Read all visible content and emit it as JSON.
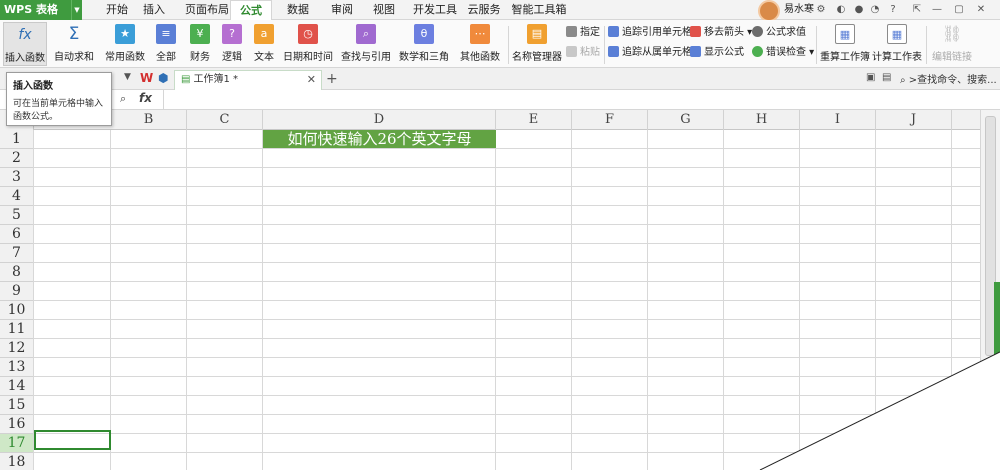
{
  "app": {
    "name": "WPS 表格"
  },
  "menu": {
    "tabs": [
      "开始",
      "插入",
      "页面布局",
      "公式",
      "数据",
      "审阅",
      "视图",
      "开发工具",
      "云服务",
      "智能工具箱"
    ],
    "active": "公式"
  },
  "user": {
    "name": "易水寒"
  },
  "ribbon": {
    "insert_function": "插入函数",
    "autosum": "自动求和",
    "common_functions": "常用函数",
    "all": "全部",
    "finance": "财务",
    "logic": "逻辑",
    "text": "文本",
    "datetime": "日期和时间",
    "lookup": "查找与引用",
    "math": "数学和三角",
    "other": "其他函数",
    "name_manager": "名称管理器",
    "specify": "指定",
    "paste": "粘贴",
    "trace_precedents": "追踪引用单元格",
    "trace_dependents": "追踪从属单元格",
    "remove_arrows": "移去箭头",
    "show_formulas": "显示公式",
    "evaluate_formula": "公式求值",
    "error_check": "错误检查",
    "recalc_workbook": "重算工作簿",
    "calc_sheet": "计算工作表",
    "edit_links": "编辑链接"
  },
  "tooltip": {
    "title": "插入函数",
    "desc": "可在当前单元格中输入函数公式。"
  },
  "docbar": {
    "doc_tab": "工作簿1 *",
    "search_command": "查找命令、搜索..."
  },
  "formula_bar": {
    "fx_label": "fx"
  },
  "sheet": {
    "columns": [
      "B",
      "C",
      "D",
      "E",
      "F",
      "G",
      "H",
      "I",
      "J"
    ],
    "rows": [
      "1",
      "2",
      "3",
      "4",
      "5",
      "6",
      "7",
      "8",
      "9",
      "10",
      "11",
      "12",
      "13",
      "14",
      "15",
      "16",
      "17",
      "18"
    ],
    "active_row": "17",
    "title_cell": "如何快速输入26个英文字母"
  },
  "colors": {
    "accent": "#3f9b3f",
    "title_fill": "#62a343"
  }
}
